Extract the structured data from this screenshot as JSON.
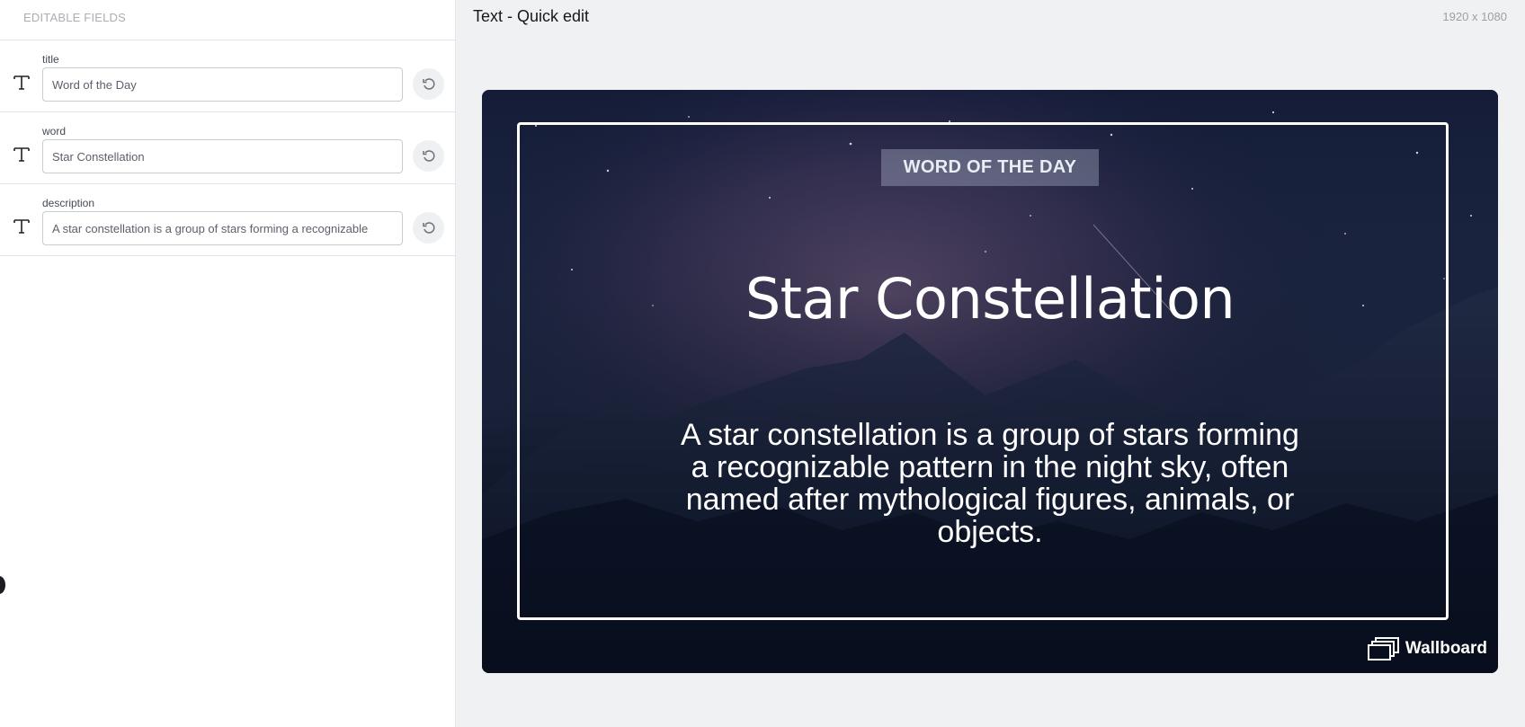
{
  "panel": {
    "header": "EDITABLE FIELDS",
    "fields": [
      {
        "label": "title",
        "value": "Word of the Day",
        "type_icon": "text-type-icon",
        "reset_icon": "undo-icon"
      },
      {
        "label": "word",
        "value": "Star Constellation",
        "type_icon": "text-type-icon",
        "reset_icon": "undo-icon"
      },
      {
        "label": "description",
        "value": "A star constellation is a group of stars forming a recognizable",
        "type_icon": "text-type-icon",
        "reset_icon": "undo-icon"
      }
    ]
  },
  "editor": {
    "title": "Text - Quick edit",
    "resolution": "1920 x 1080"
  },
  "preview": {
    "badge": "WORD OF THE DAY",
    "word": "Star Constellation",
    "description": "A star constellation is a group of stars forming a recognizable pattern in the night sky, often named after mythological figures, animals, or objects.",
    "brand": "Wallboard",
    "brand_icon": "wallboard-logo-icon"
  },
  "colors": {
    "panel_bg": "#ffffff",
    "canvas_bg": "#f0f1f3",
    "sky_top": "#141c38",
    "sky_glow": "#6a4a78",
    "mountains": "#2a3552"
  }
}
